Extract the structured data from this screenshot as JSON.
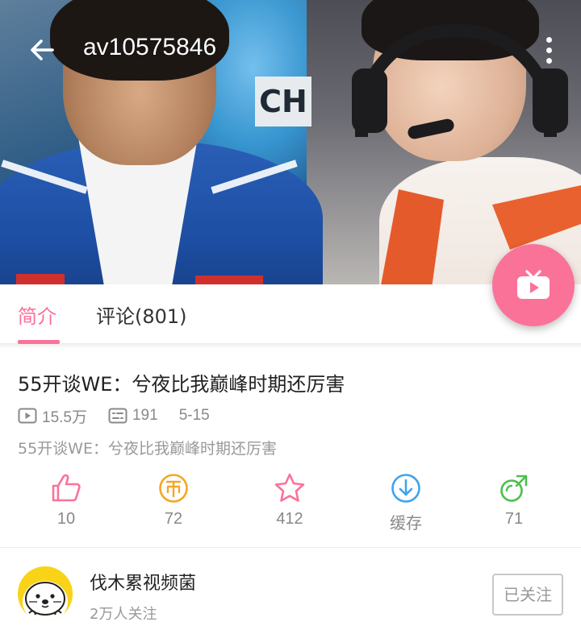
{
  "header": {
    "title": "av10575846",
    "back_icon": "arrow-left-icon",
    "more_icon": "more-vertical-icon"
  },
  "hero": {
    "sign_text": "CH"
  },
  "tabs": [
    {
      "label": "简介",
      "active": true
    },
    {
      "label": "评论(801)",
      "active": false
    }
  ],
  "fab": {
    "icon": "tv-play-icon"
  },
  "video": {
    "title": "55开谈WE：兮夜比我巅峰时期还厉害",
    "plays": "15.5万",
    "danmaku": "191",
    "date": "5-15",
    "description": "55开谈WE：兮夜比我巅峰时期还厉害"
  },
  "actions": [
    {
      "icon": "thumbs-up-icon",
      "label": "10"
    },
    {
      "icon": "coin-icon",
      "label": "72"
    },
    {
      "icon": "star-icon",
      "label": "412"
    },
    {
      "icon": "download-icon",
      "label": "缓存"
    },
    {
      "icon": "share-icon",
      "label": "71"
    }
  ],
  "uploader": {
    "name": "伐木累视频菌",
    "followers": "2万人关注",
    "follow_label": "已关注"
  },
  "colors": {
    "accent": "#fb7299",
    "coin": "#f5a623",
    "download": "#3ea4ee",
    "share": "#4cbf4c"
  }
}
